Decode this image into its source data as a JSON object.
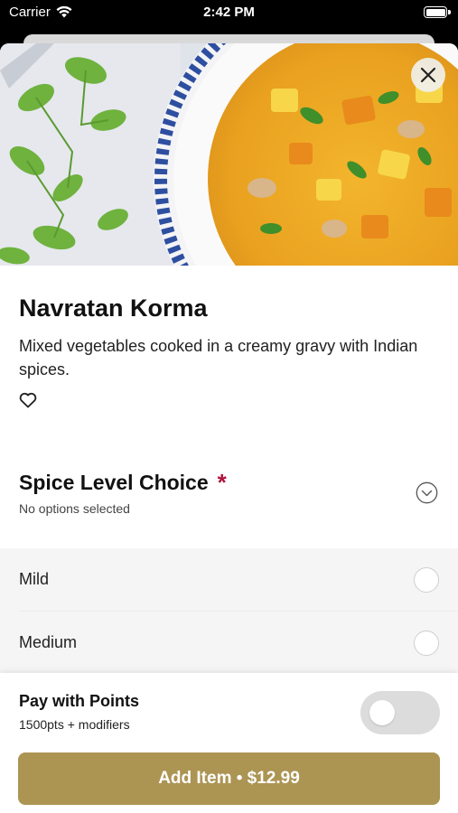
{
  "status_bar": {
    "carrier": "Carrier",
    "time": "2:42 PM"
  },
  "item": {
    "name": "Navratan Korma",
    "description": "Mixed vegetables cooked in a creamy gravy with Indian spices."
  },
  "modifier_group": {
    "title": "Spice Level Choice",
    "required_marker": "*",
    "selection_status": "No options selected",
    "options": [
      {
        "label": "Mild",
        "selected": false
      },
      {
        "label": "Medium",
        "selected": false
      }
    ]
  },
  "points": {
    "title": "Pay with Points",
    "detail": "1500pts + modifiers",
    "enabled": false
  },
  "add_button": {
    "label": "Add Item • $12.99"
  },
  "colors": {
    "accent": "#ac9453",
    "required": "#b0123c"
  },
  "icons": [
    "wifi-icon",
    "battery-icon",
    "close-icon",
    "heart-icon",
    "chevron-down-icon"
  ]
}
